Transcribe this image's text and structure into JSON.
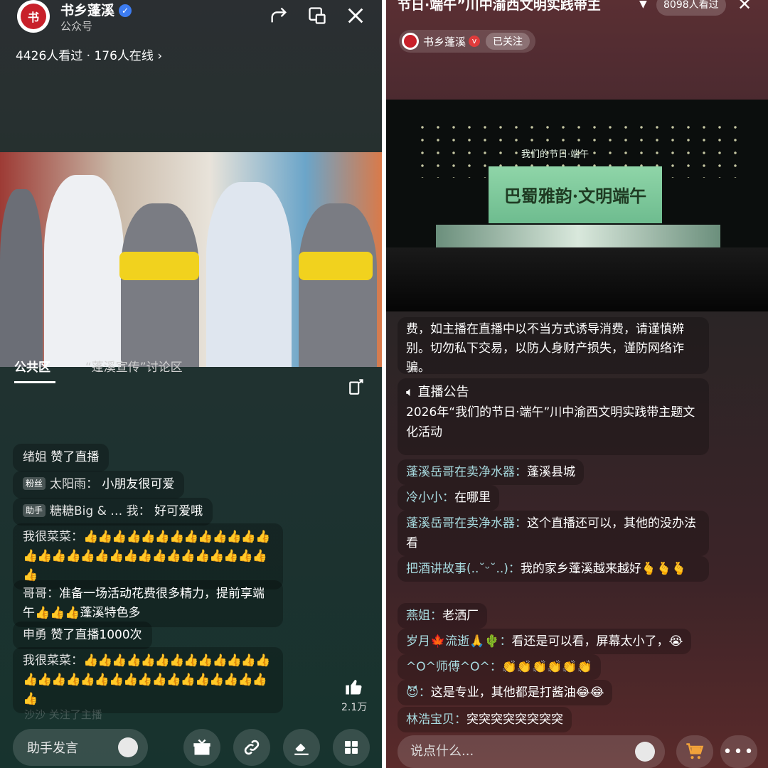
{
  "left": {
    "account": {
      "name": "书乡蓬溪",
      "type": "公众号",
      "logo_text": "书"
    },
    "viewers": "4426人看过 · 176人在线",
    "tabs": [
      "公共区",
      "“蓬溪宣传”讨论区"
    ],
    "messages": [
      {
        "name": "绪姐",
        "text": "赞了直播"
      },
      {
        "badge": "粉丝",
        "name": "太阳雨：",
        "text": "小朋友很可爱"
      },
      {
        "badge": "助手",
        "name": "糖糖Big & … 我：",
        "text": "好可爱哦"
      },
      {
        "name": "我很菜菜：",
        "text": "👍👍👍👍👍👍👍👍👍👍👍👍👍👍👍👍👍👍👍👍👍👍👍👍👍👍👍👍👍👍👍"
      },
      {
        "name": "哥哥：",
        "text": "准备一场活动花费很多精力，提前享端午👍👍👍蓬溪特色多"
      },
      {
        "name": "申勇",
        "text": "赞了直播1000次"
      },
      {
        "name": "我很菜菜：",
        "text": "👍👍👍👍👍👍👍👍👍👍👍👍👍👍👍👍👍👍👍👍👍👍👍👍👍👍👍👍👍👍👍"
      }
    ],
    "faded_message": "沙沙 关注了主播",
    "like_count": "2.1万",
    "assistant_input": "助手发言"
  },
  "right": {
    "title": "节日·端午”川中渝西文明实践带主",
    "viewers": "8098人看过",
    "host": {
      "name": "书乡蓬溪",
      "follow_status": "已关注"
    },
    "stage": {
      "top": "我们的节日·端午",
      "main": "巴蜀雅韵·文明端午"
    },
    "warning_text": "费，如主播在直播中以不当方式诱导消费，请谨慎辨别。切勿私下交易，以防人身财产损失，谨防网络诈骗。",
    "notice": {
      "title": "直播公告",
      "text": "2026年“我们的节日·端午”川中渝西文明实践带主题文化活动"
    },
    "messages": [
      {
        "name": "蓬溪岳哥在卖净水器：",
        "text": "蓬溪县城"
      },
      {
        "name": "冷小小：",
        "text": "在哪里"
      },
      {
        "name": "蓬溪岳哥在卖净水器：",
        "text": "这个直播还可以，其他的没办法看"
      },
      {
        "name": "把酒讲故事(..˘ᵕ˘..)：",
        "text": "我的家乡蓬溪越来越好🫰🫰🫰"
      },
      {
        "name": "燕姐：",
        "text": "老洒厂"
      },
      {
        "name": "岁月🍁流逝🙏🌵：",
        "text": "看还是可以看，屏幕太小了，😭"
      },
      {
        "name": "^O^师傅^O^：",
        "text": "👏👏👏👏👏👏"
      },
      {
        "name": "😈：",
        "text": "这是专业，其他都是打酱油😂😂"
      },
      {
        "name": "林浩宝贝：",
        "text": "突突突突突突突突"
      }
    ],
    "input_placeholder": "说点什么..."
  }
}
